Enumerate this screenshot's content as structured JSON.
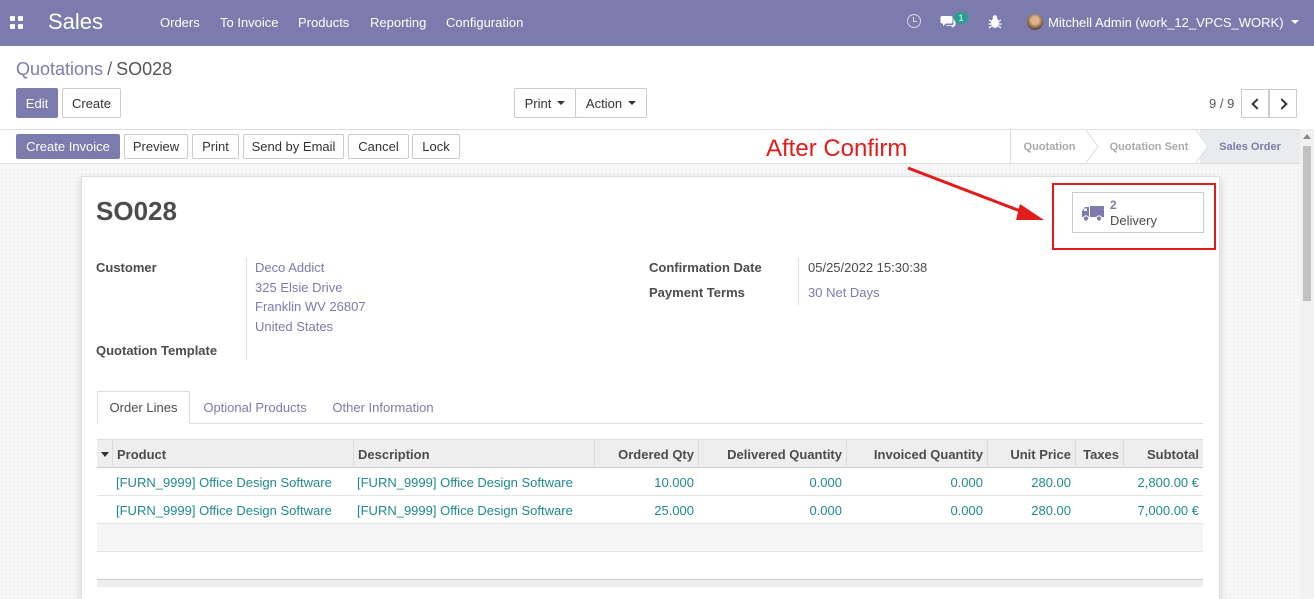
{
  "navbar": {
    "brand": "Sales",
    "menu": [
      "Orders",
      "To Invoice",
      "Products",
      "Reporting",
      "Configuration"
    ],
    "chat_badge": "1",
    "user": "Mitchell Admin (work_12_VPCS_WORK)"
  },
  "breadcrumb": {
    "parent": "Quotations",
    "separator": "/",
    "current": "SO028"
  },
  "control": {
    "edit": "Edit",
    "create": "Create",
    "print": "Print",
    "action": "Action",
    "pager": "9 / 9"
  },
  "statusbar": {
    "buttons": [
      "Create Invoice",
      "Preview",
      "Print",
      "Send by Email",
      "Cancel",
      "Lock"
    ],
    "stages": [
      "Quotation",
      "Quotation Sent",
      "Sales Order"
    ],
    "current_stage": "Sales Order"
  },
  "annotation": {
    "text": "After Confirm",
    "color": "#e21b1b"
  },
  "form": {
    "name": "SO028",
    "smart_button": {
      "count": "2",
      "label": "Delivery"
    },
    "customer_label": "Customer",
    "customer_lines": [
      "Deco Addict",
      "325 Elsie Drive",
      "Franklin WV 26807",
      "United States"
    ],
    "quotation_template_label": "Quotation Template",
    "confirmation_date_label": "Confirmation Date",
    "confirmation_date": "05/25/2022 15:30:38",
    "payment_terms_label": "Payment Terms",
    "payment_terms": "30 Net Days"
  },
  "tabs": [
    "Order Lines",
    "Optional Products",
    "Other Information"
  ],
  "table": {
    "columns": [
      "Product",
      "Description",
      "Ordered Qty",
      "Delivered Quantity",
      "Invoiced Quantity",
      "Unit Price",
      "Taxes",
      "Subtotal"
    ],
    "rows": [
      [
        "[FURN_9999] Office Design Software",
        "[FURN_9999] Office Design Software",
        "10.000",
        "0.000",
        "0.000",
        "280.00",
        "",
        "2,800.00 €"
      ],
      [
        "[FURN_9999] Office Design Software",
        "[FURN_9999] Office Design Software",
        "25.000",
        "0.000",
        "0.000",
        "280.00",
        "",
        "7,000.00 €"
      ]
    ]
  },
  "colors": {
    "brand": "#7c7bad",
    "link_teal": "#208a8a",
    "annotation_red": "#e21b1b"
  }
}
